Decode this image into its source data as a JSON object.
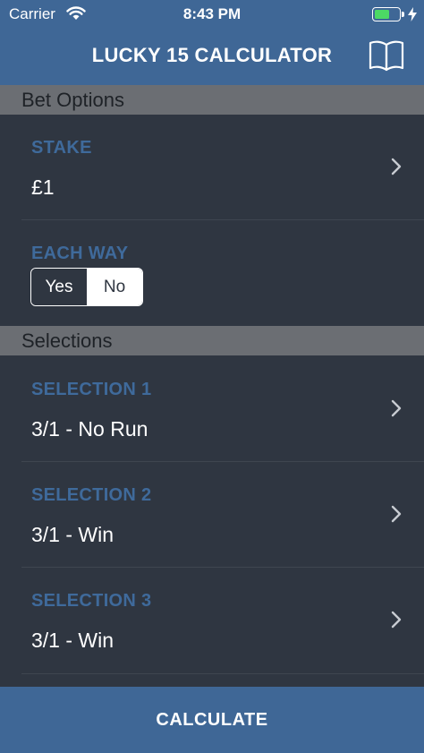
{
  "status_bar": {
    "carrier": "Carrier",
    "time": "8:43 PM",
    "battery_level": 0.6
  },
  "header": {
    "title": "LUCKY 15 CALCULATOR",
    "icon": "book-icon"
  },
  "sections": {
    "bet_options": "Bet Options",
    "selections": "Selections"
  },
  "stake": {
    "label": "STAKE",
    "value": "£1"
  },
  "each_way": {
    "label": "EACH WAY",
    "options": [
      "Yes",
      "No"
    ],
    "selected": "No"
  },
  "selection_rows": [
    {
      "label": "SELECTION 1",
      "value": "3/1 - No Run"
    },
    {
      "label": "SELECTION 2",
      "value": "3/1 - Win"
    },
    {
      "label": "SELECTION 3",
      "value": "3/1 - Win"
    }
  ],
  "calculate": {
    "label": "CALCULATE"
  },
  "colors": {
    "header_bg": "#3f6796",
    "body_bg": "#2f3641",
    "section_bg": "#6b6e73",
    "label_blue": "#3f6a9b",
    "battery_green": "#4cd964"
  }
}
